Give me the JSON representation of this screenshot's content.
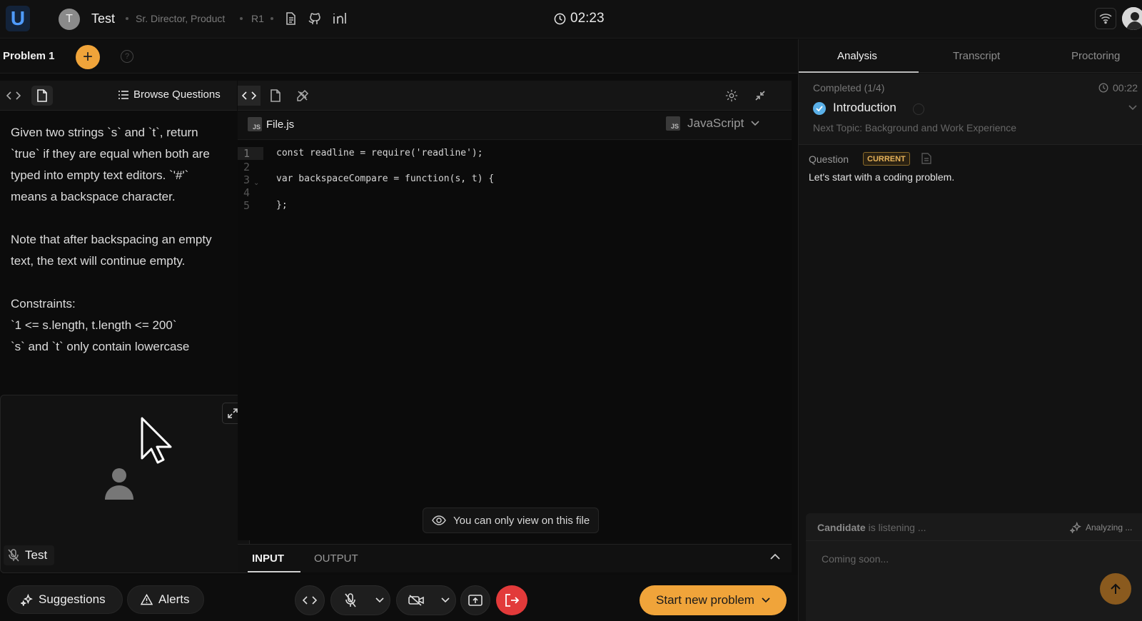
{
  "app": {
    "logo_letter": "U"
  },
  "header": {
    "avatar_initial": "T",
    "candidate_name": "Test",
    "role": "Sr. Director, Product",
    "round": "R1",
    "timer": "02:23"
  },
  "problem_tabs": {
    "active_tab": "Problem 1",
    "add_label": "+",
    "help_label": "?"
  },
  "left_panel": {
    "browse_label": "Browse Questions",
    "question_paragraphs": [
      "Given two strings `s` and `t`, return `true` if they are equal when both are typed into empty text editors. `'#'` means a backspace character.",
      "Note that after backspacing an empty text, the text will continue empty."
    ],
    "constraints_heading": "Constraints:",
    "constraints": [
      "`1 <= s.length, t.length <= 200`",
      "`s` and `t` only contain lowercase"
    ]
  },
  "video_tile": {
    "participant_name": "Test"
  },
  "editor": {
    "file_name": "File.js",
    "file_badge": "JS",
    "language": "JavaScript",
    "line_numbers": [
      "1",
      "2",
      "3",
      "4",
      "5"
    ],
    "code_lines": [
      "const readline = require('readline');",
      "",
      "var backspaceCompare = function(s, t) {",
      "",
      "};"
    ],
    "view_only_notice": "You can only view on this file",
    "io_tabs": [
      "INPUT",
      "OUTPUT"
    ]
  },
  "bottom_bar": {
    "suggestions_label": "Suggestions",
    "alerts_label": "Alerts",
    "start_label": "Start new problem"
  },
  "right_panel": {
    "tabs": [
      "Analysis",
      "Transcript",
      "Proctoring"
    ],
    "completed": "Completed (1/4)",
    "topic_time": "00:22",
    "topic_title": "Introduction",
    "next_topic": "Next Topic: Background and Work Experience",
    "question_label": "Question",
    "current_badge": "CURRENT",
    "question_text": "Let's start with a coding problem.",
    "listen_subject": "Candidate",
    "listen_status": "is listening ...",
    "analyzing": "Analyzing ...",
    "coming_soon": "Coming soon..."
  },
  "colors": {
    "accent_orange": "#f0a43a",
    "exit_red": "#e23a3a",
    "check_blue": "#5ab0e8",
    "logo_blue": "#4f9bff"
  }
}
